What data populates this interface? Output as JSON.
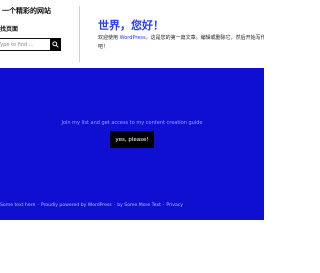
{
  "header": {
    "site_title": "一个精彩的网站",
    "section_label": "找页面"
  },
  "search": {
    "placeholder": "Type to find ..."
  },
  "post": {
    "title": "世界，您好！",
    "body_part1": "欢迎使用 ",
    "body_link": "WordPress",
    "body_part2": "。这是您的第一篇文章。编辑或删除它，然后开始写作吧！"
  },
  "band": {
    "prompt": "Join my list and get access to my content creation guide",
    "cta_label": "yes, please!"
  },
  "footer": {
    "text1": "Some text here",
    "sep1": "·",
    "text2": "Proudly powered by WordPress",
    "sep2": "·",
    "text3": "by Some More Text",
    "sep3": "·",
    "text4": "Privacy"
  },
  "colors": {
    "accent": "#2b3cf5",
    "band_bg": "#0f0fd2",
    "button_bg": "#000000"
  }
}
